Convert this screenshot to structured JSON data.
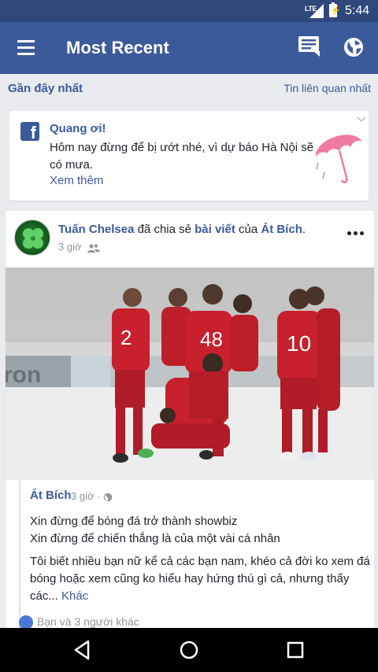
{
  "status_bar": {
    "network": "LTE",
    "battery_icon": "battery-charging-icon",
    "time": "5:44"
  },
  "app_bar": {
    "title": "Most Recent",
    "background": "#3b5a9a"
  },
  "sort": {
    "label": "Gần đây nhất",
    "alt_option": "Tin liên quan nhất"
  },
  "weather_card": {
    "greeting": "Quang ơi!",
    "message": "Hôm nay đừng để bị ướt nhé, vì dự báo Hà Nội sẽ có mưa.",
    "see_more": "Xem thêm",
    "umbrella_color": "#f07aa0"
  },
  "post": {
    "sharer": "Tuấn Chelsea",
    "shared_text": " đã chia sẻ ",
    "post_link": "bài viết",
    "of_text": " của ",
    "original_author": "Át Bích",
    "period": ".",
    "time": "3 giờ",
    "shared_post": {
      "author": "Át Bích",
      "time": "3 giờ ·",
      "line1": "Xin đừng để bóng đá trở thành showbiz",
      "line2": "Xin đừng để chiến thắng là của một vài cá nhân",
      "paragraph": "Tôi biết nhiều bạn nữ kể cả các bạn nam, khéo cả đời ko xem đá bóng hoặc xem cũng ko hiểu hay hứng thú gì cả, nhưng thấy các...",
      "more": " Khác"
    },
    "reactions": "Bạn và 3 người khác"
  },
  "photo": {
    "jersey_numbers": [
      "2",
      "48",
      "10"
    ],
    "banner_text": "ron"
  }
}
